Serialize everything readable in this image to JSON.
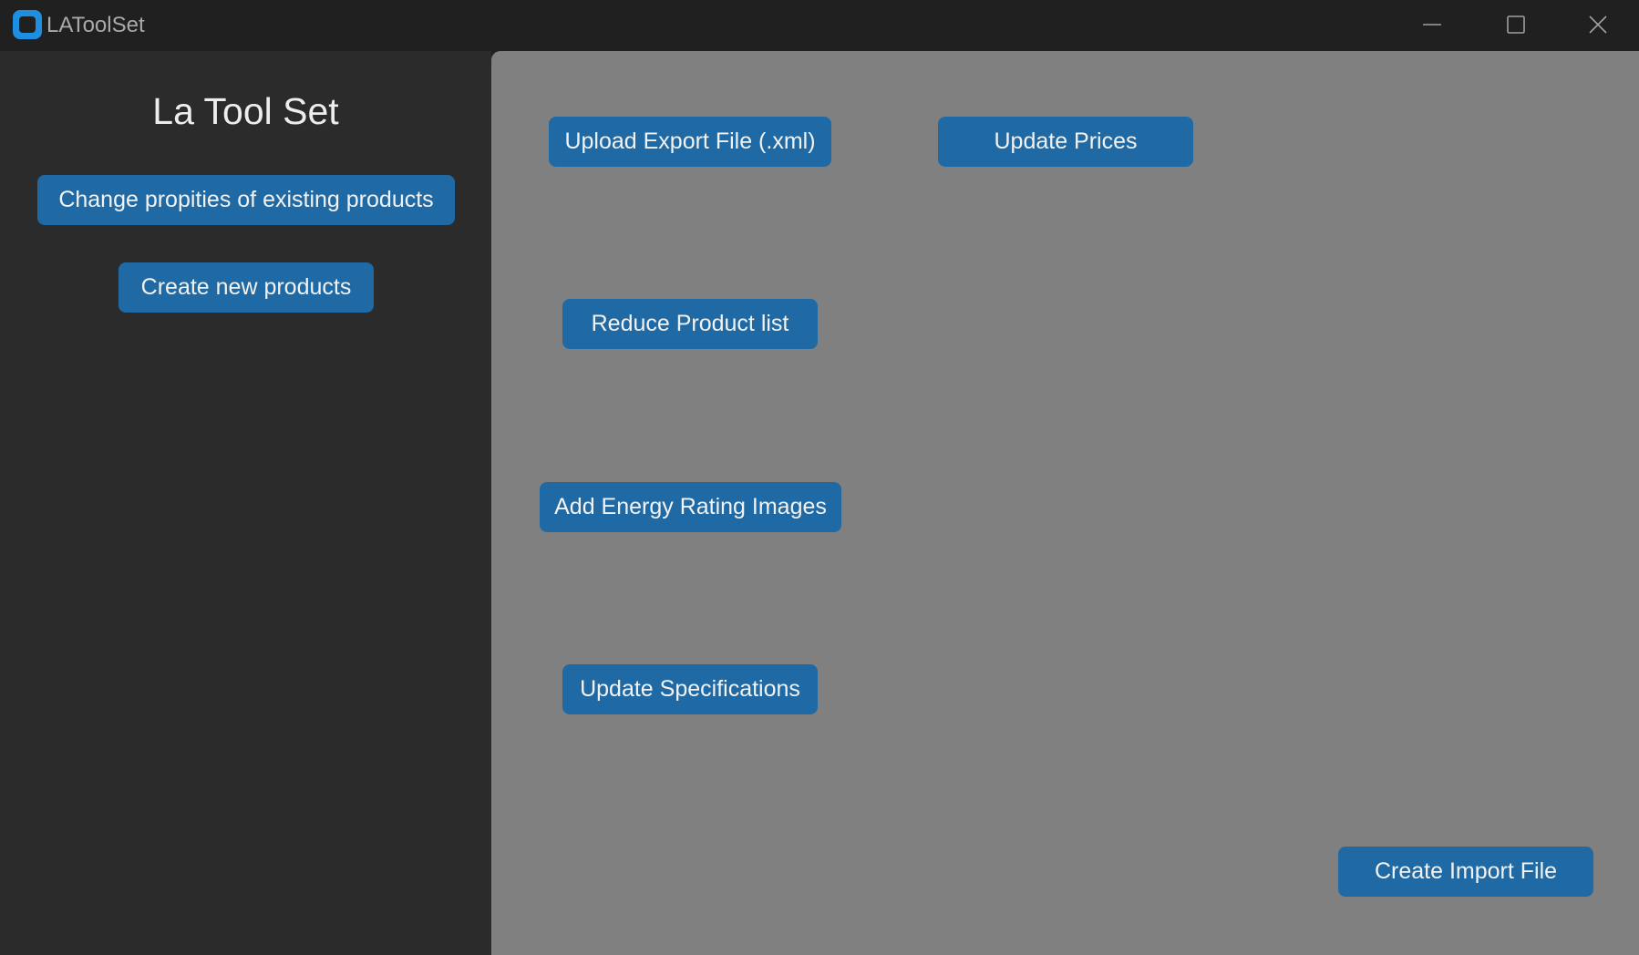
{
  "window": {
    "title": "LAToolSet",
    "icon": "app-logo-icon",
    "controls": [
      "minimize-icon",
      "maximize-icon",
      "close-icon"
    ]
  },
  "sidebar": {
    "title": "La Tool Set",
    "buttons": [
      {
        "label": "Change propities of existing products"
      },
      {
        "label": "Create new products"
      }
    ]
  },
  "main": {
    "buttons": {
      "upload_export": "Upload Export File (.xml)",
      "update_prices": "Update Prices",
      "reduce_product_list": "Reduce Product list",
      "add_energy_rating_images": "Add Energy Rating Images",
      "update_specifications": "Update Specifications",
      "create_import_file": "Create Import File"
    }
  },
  "colors": {
    "titlebar_bg": "#202020",
    "sidebar_bg": "#2b2b2b",
    "main_bg": "#808080",
    "button_bg": "#1f6aa5",
    "button_text": "#f2f2f2",
    "app_icon": "#1e8fe0"
  }
}
